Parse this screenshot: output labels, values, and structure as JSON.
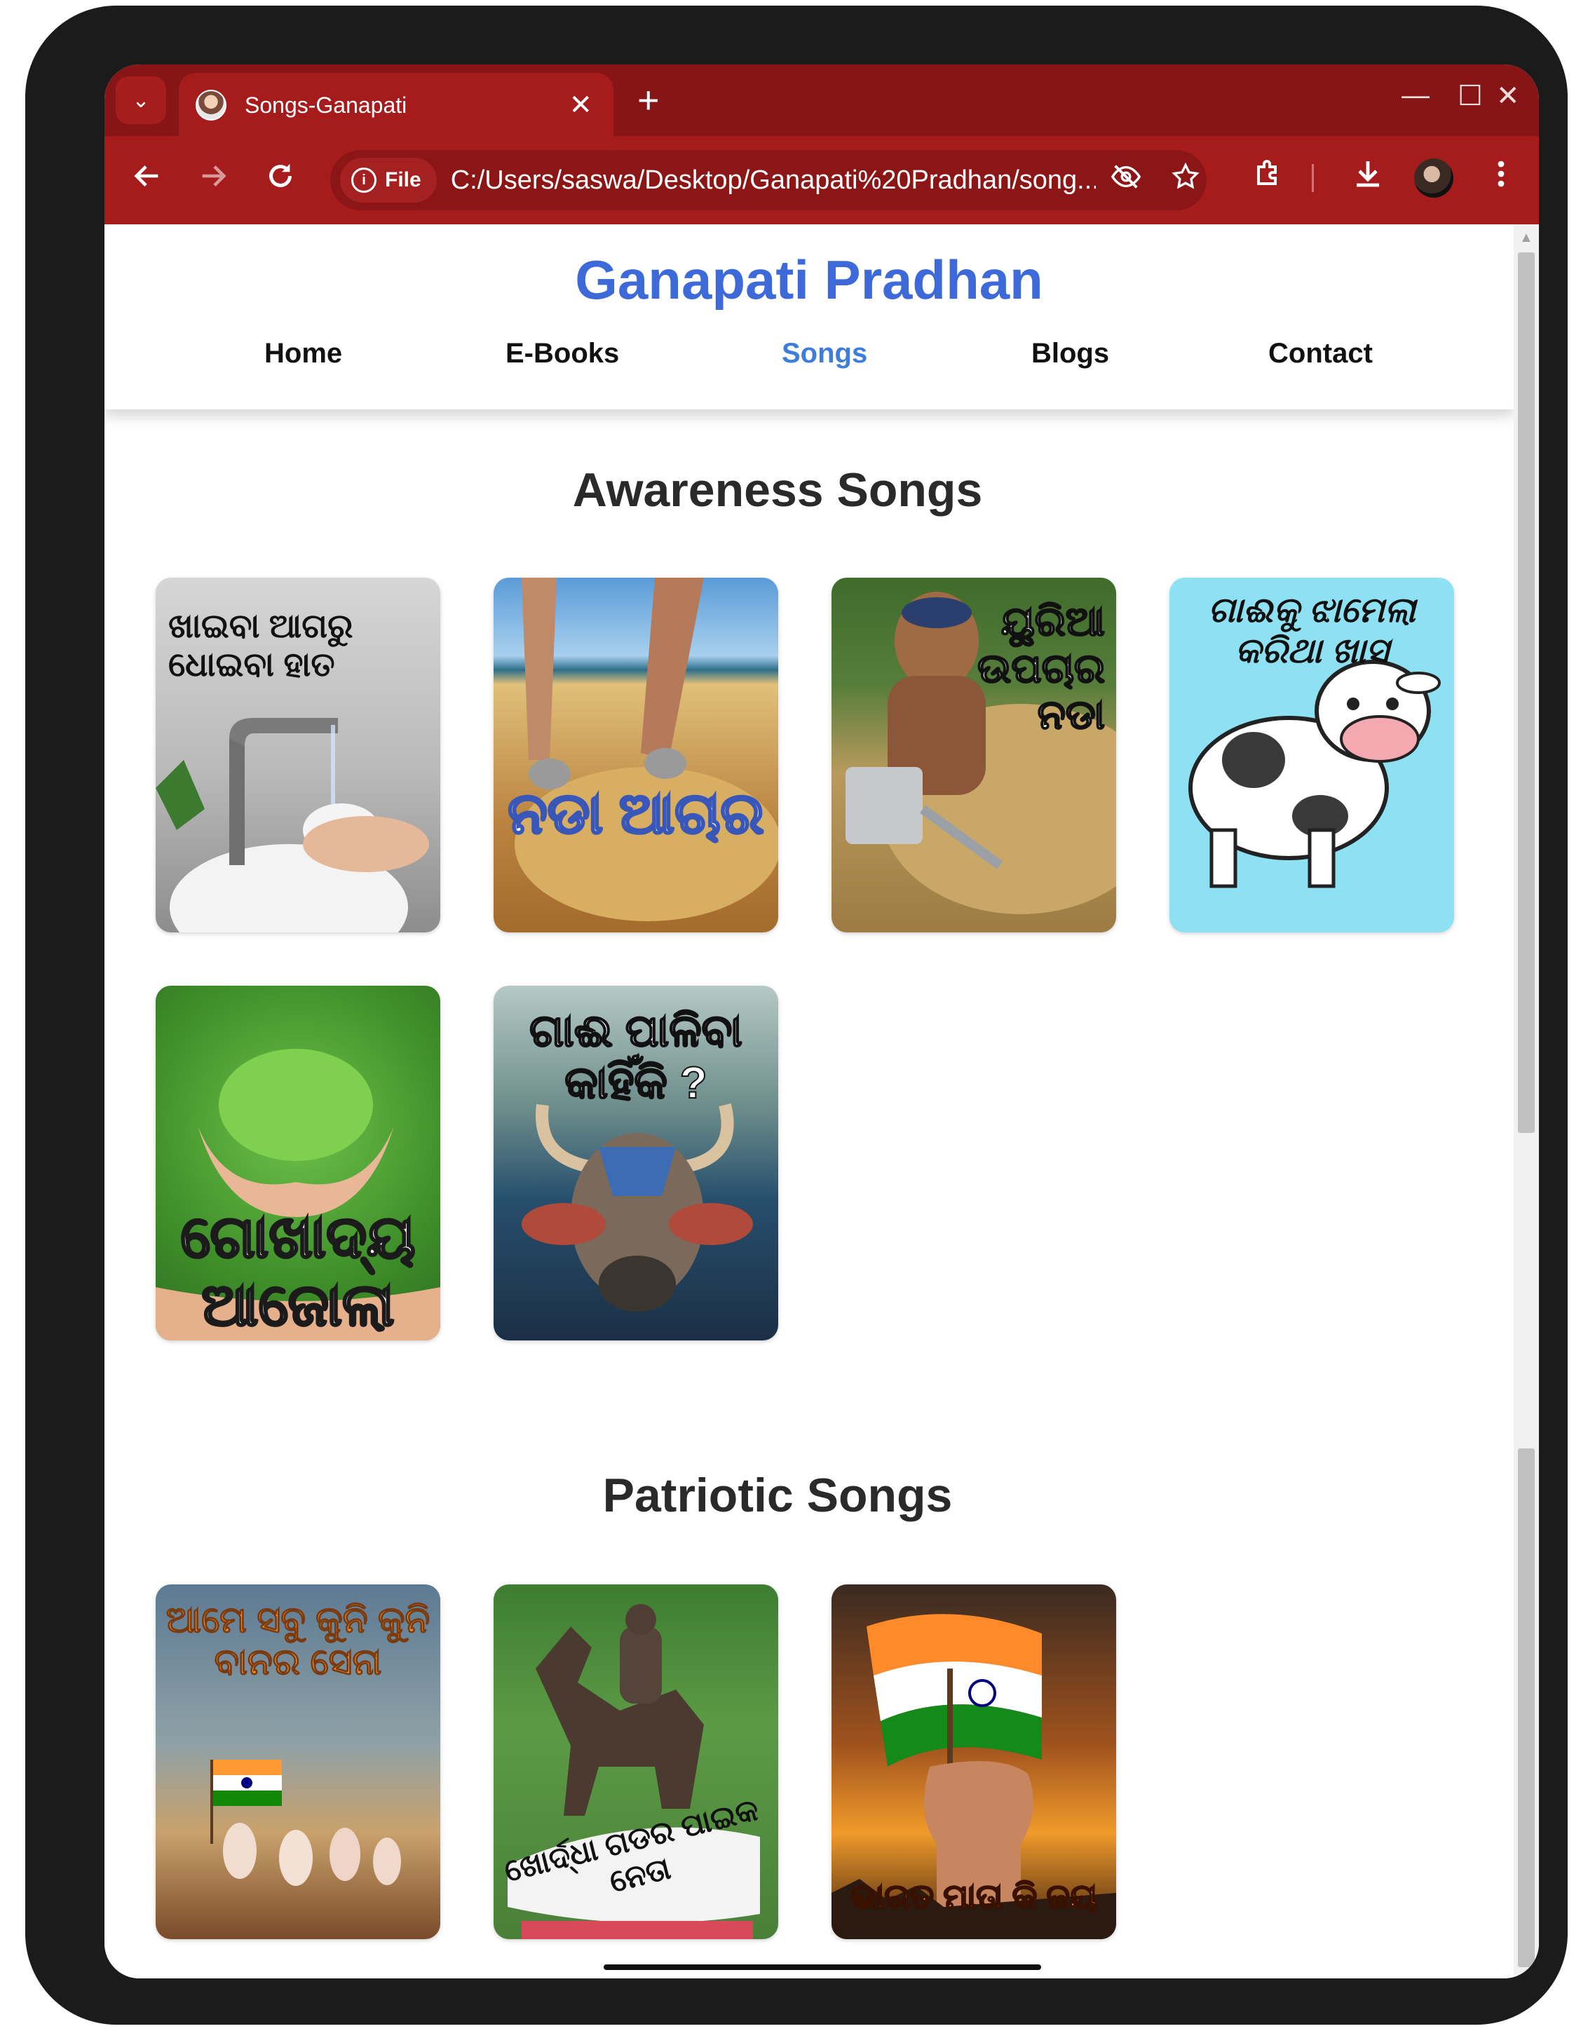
{
  "browser": {
    "tab_title": "Songs-Ganapati",
    "tab_close": "✕",
    "new_tab": "+",
    "file_chip": "File",
    "url": "C:/Users/saswa/Desktop/Ganapati%20Pradhan/song...",
    "window_controls": {
      "minimize": "—",
      "maximize": "☐",
      "close": "✕"
    },
    "icons": {
      "tab_search": "chevron-down-icon",
      "back": "back-arrow-icon",
      "forward": "forward-arrow-icon",
      "reload": "reload-icon",
      "eye_off": "eye-off-icon",
      "star": "star-icon",
      "extensions": "extensions-icon",
      "download": "download-icon",
      "menu": "kebab-menu-icon"
    }
  },
  "site": {
    "title": "Ganapati Pradhan",
    "nav": [
      {
        "label": "Home",
        "active": false
      },
      {
        "label": "E-Books",
        "active": false
      },
      {
        "label": "Songs",
        "active": true
      },
      {
        "label": "Blogs",
        "active": false
      },
      {
        "label": "Contact",
        "active": false
      }
    ]
  },
  "sections": [
    {
      "title": "Awareness Songs",
      "cards": [
        {
          "caption": "ଖାଇବା ଆଗରୁ ଧୋଇବା ହାତ",
          "theme": "hand-washing"
        },
        {
          "caption": "ନଡା ଆଚାର",
          "theme": "straw-bundle"
        },
        {
          "caption": "ୟୁରିଆ ଉପଚାର ନଡା",
          "theme": "urea-straw"
        },
        {
          "caption": "ଗାଈକୁ ଝାମେଲା କରିଥା ଖାସ",
          "theme": "cartoon-cow"
        },
        {
          "caption": "ଗୋଖାଦ୍ୟ ଆଜୋଲା",
          "theme": "azolla"
        },
        {
          "caption": "ଗାଈ ପାଳିବା କାହିଁକି ?",
          "theme": "bull"
        }
      ]
    },
    {
      "title": "Patriotic Songs",
      "cards": [
        {
          "caption": "ଆମେ ସବୁ କୁନି କୁନି ବାନର ସେନା",
          "theme": "children-flag"
        },
        {
          "caption": "ଖୋର୍ଦ୍ଧା ଗଡର ପାଇକ ନେତା",
          "theme": "horse-statue"
        },
        {
          "caption": "ଭାରତ ମାତା କି ଜୟ",
          "theme": "fist-flag"
        }
      ]
    }
  ],
  "colors": {
    "browser_titlebar": "#871515",
    "browser_toolbar": "#a61c1c",
    "site_title": "#3e6ad9",
    "active_nav": "#3d7ddc"
  }
}
